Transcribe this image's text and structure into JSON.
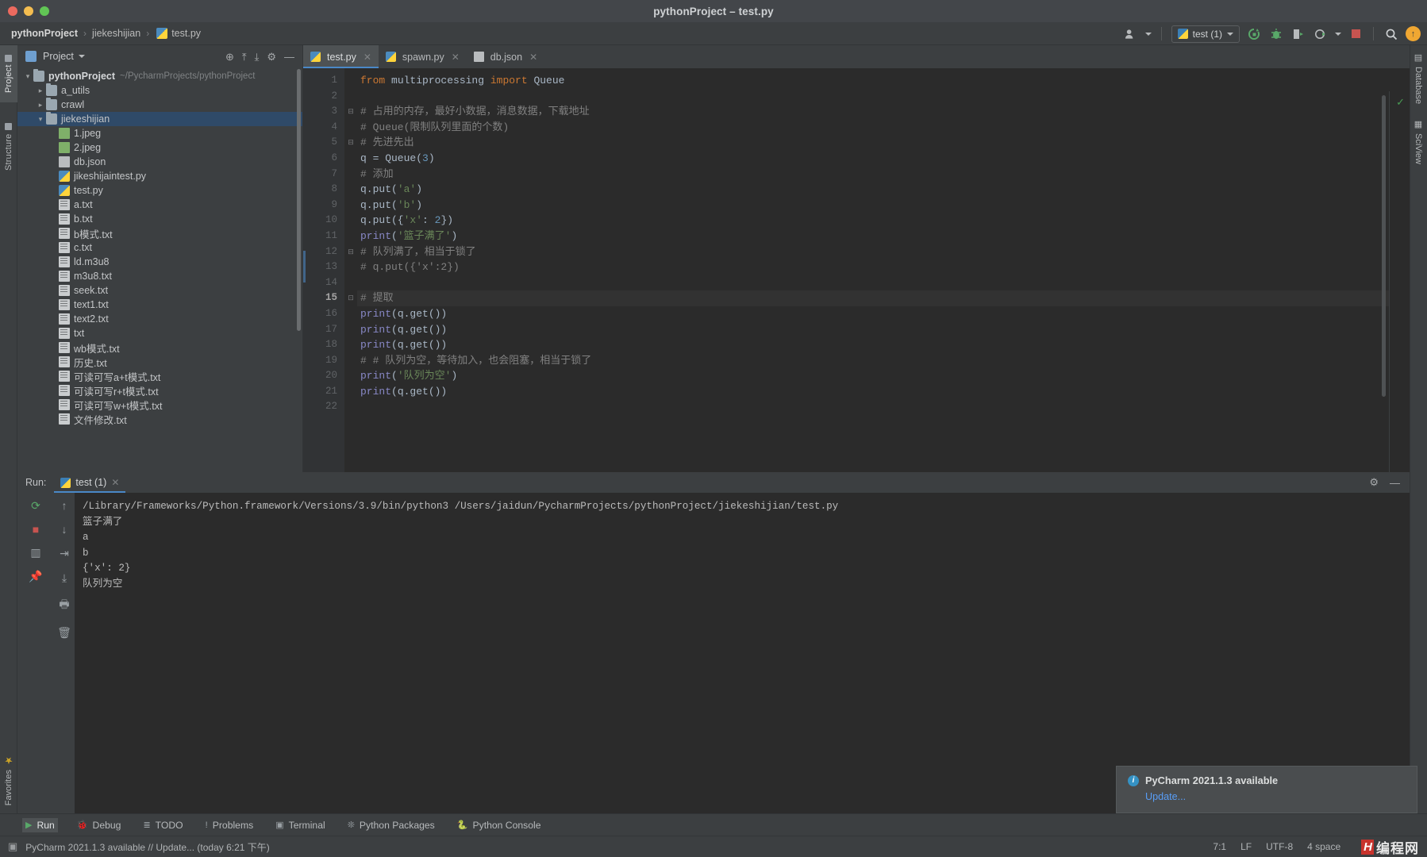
{
  "window": {
    "title": "pythonProject – test.py"
  },
  "breadcrumb": {
    "project": "pythonProject",
    "folder": "jiekeshijian",
    "file": "test.py",
    "separator": "›"
  },
  "toolbar": {
    "run_config": "test (1)",
    "icons": [
      "user-icon",
      "rerun-icon",
      "debug-icon",
      "coverage-icon",
      "profile-icon",
      "stop-icon",
      "search-icon",
      "update-icon"
    ]
  },
  "left_strip": {
    "tabs": [
      {
        "label": "Project",
        "icon": "folder-icon",
        "active": true
      },
      {
        "label": "Structure",
        "icon": "structure-icon",
        "active": false
      }
    ],
    "favorites": "Favorites"
  },
  "right_strip": {
    "tabs": [
      {
        "label": "Database",
        "icon": "database-icon"
      },
      {
        "label": "SciView",
        "icon": "grid-icon"
      }
    ]
  },
  "project_panel": {
    "title": "Project",
    "tools": [
      "target-icon",
      "collapse-icon",
      "expand-icon",
      "gear-icon",
      "minimize-icon"
    ],
    "tree": [
      {
        "indent": 0,
        "arrow": "v",
        "icon": "folder-icon",
        "name": "pythonProject",
        "bold": true,
        "path": "~/PycharmProjects/pythonProject",
        "selected": false
      },
      {
        "indent": 1,
        "arrow": ">",
        "icon": "folder-icon",
        "name": "a_utils",
        "bold": false,
        "path": "",
        "selected": false
      },
      {
        "indent": 1,
        "arrow": ">",
        "icon": "folder-icon",
        "name": "crawl",
        "bold": false,
        "path": "",
        "selected": false
      },
      {
        "indent": 1,
        "arrow": "v",
        "icon": "folder-icon",
        "name": "jiekeshijian",
        "bold": false,
        "path": "",
        "selected": true
      },
      {
        "indent": 2,
        "arrow": "",
        "icon": "image-icon",
        "name": "1.jpeg",
        "bold": false,
        "path": "",
        "selected": false
      },
      {
        "indent": 2,
        "arrow": "",
        "icon": "image-icon",
        "name": "2.jpeg",
        "bold": false,
        "path": "",
        "selected": false
      },
      {
        "indent": 2,
        "arrow": "",
        "icon": "json-icon",
        "name": "db.json",
        "bold": false,
        "path": "",
        "selected": false
      },
      {
        "indent": 2,
        "arrow": "",
        "icon": "python-icon",
        "name": "jikeshijaintest.py",
        "bold": false,
        "path": "",
        "selected": false
      },
      {
        "indent": 2,
        "arrow": "",
        "icon": "python-icon",
        "name": "test.py",
        "bold": false,
        "path": "",
        "selected": false
      },
      {
        "indent": 2,
        "arrow": "",
        "icon": "text-icon",
        "name": "a.txt",
        "bold": false,
        "path": "",
        "selected": false
      },
      {
        "indent": 2,
        "arrow": "",
        "icon": "text-icon",
        "name": "b.txt",
        "bold": false,
        "path": "",
        "selected": false
      },
      {
        "indent": 2,
        "arrow": "",
        "icon": "text-icon",
        "name": "b模式.txt",
        "bold": false,
        "path": "",
        "selected": false
      },
      {
        "indent": 2,
        "arrow": "",
        "icon": "text-icon",
        "name": "c.txt",
        "bold": false,
        "path": "",
        "selected": false
      },
      {
        "indent": 2,
        "arrow": "",
        "icon": "text-icon",
        "name": "ld.m3u8",
        "bold": false,
        "path": "",
        "selected": false
      },
      {
        "indent": 2,
        "arrow": "",
        "icon": "text-icon",
        "name": "m3u8.txt",
        "bold": false,
        "path": "",
        "selected": false
      },
      {
        "indent": 2,
        "arrow": "",
        "icon": "text-icon",
        "name": "seek.txt",
        "bold": false,
        "path": "",
        "selected": false
      },
      {
        "indent": 2,
        "arrow": "",
        "icon": "text-icon",
        "name": "text1.txt",
        "bold": false,
        "path": "",
        "selected": false
      },
      {
        "indent": 2,
        "arrow": "",
        "icon": "text-icon",
        "name": "text2.txt",
        "bold": false,
        "path": "",
        "selected": false
      },
      {
        "indent": 2,
        "arrow": "",
        "icon": "text-icon",
        "name": "txt",
        "bold": false,
        "path": "",
        "selected": false
      },
      {
        "indent": 2,
        "arrow": "",
        "icon": "text-icon",
        "name": "wb模式.txt",
        "bold": false,
        "path": "",
        "selected": false
      },
      {
        "indent": 2,
        "arrow": "",
        "icon": "text-icon",
        "name": "历史.txt",
        "bold": false,
        "path": "",
        "selected": false
      },
      {
        "indent": 2,
        "arrow": "",
        "icon": "text-icon",
        "name": "可读可写a+t模式.txt",
        "bold": false,
        "path": "",
        "selected": false
      },
      {
        "indent": 2,
        "arrow": "",
        "icon": "text-icon",
        "name": "可读可写r+t模式.txt",
        "bold": false,
        "path": "",
        "selected": false
      },
      {
        "indent": 2,
        "arrow": "",
        "icon": "text-icon",
        "name": "可读可写w+t模式.txt",
        "bold": false,
        "path": "",
        "selected": false
      },
      {
        "indent": 2,
        "arrow": "",
        "icon": "text-icon",
        "name": "文件修改.txt",
        "bold": false,
        "path": "",
        "selected": false
      }
    ]
  },
  "editor": {
    "tabs": [
      {
        "label": "test.py",
        "icon": "python-icon",
        "active": true
      },
      {
        "label": "spawn.py",
        "icon": "python-icon",
        "active": false
      },
      {
        "label": "db.json",
        "icon": "json-icon",
        "active": false
      }
    ],
    "current_line": 15,
    "lines": [
      {
        "n": 1,
        "fold": "",
        "html": "<span class=\"kw\">from</span> multiprocessing <span class=\"kw\">import</span> Queue"
      },
      {
        "n": 2,
        "fold": "",
        "html": ""
      },
      {
        "n": 3,
        "fold": "⊟",
        "html": "<span class=\"cmt\"># 占用的内存，最好小数据，消息数据，下载地址</span>"
      },
      {
        "n": 4,
        "fold": "",
        "html": "<span class=\"cmt\"># Queue(限制队列里面的个数)</span>"
      },
      {
        "n": 5,
        "fold": "⊟",
        "html": "<span class=\"cmt\"># 先进先出</span>"
      },
      {
        "n": 6,
        "fold": "",
        "html": "q = Queue(<span class=\"num\">3</span>)"
      },
      {
        "n": 7,
        "fold": "",
        "html": "<span class=\"cmt\"># 添加</span>"
      },
      {
        "n": 8,
        "fold": "",
        "html": "q.put(<span class=\"str\">'a'</span>)"
      },
      {
        "n": 9,
        "fold": "",
        "html": "q.put(<span class=\"str\">'b'</span>)"
      },
      {
        "n": 10,
        "fold": "",
        "html": "q.put({<span class=\"str\">'x'</span>: <span class=\"num\">2</span>})"
      },
      {
        "n": 11,
        "fold": "",
        "html": "<span class=\"fn\">print</span>(<span class=\"str\">'篮子满了'</span>)"
      },
      {
        "n": 12,
        "fold": "⊟",
        "html": "<span class=\"cmt\"># 队列满了，相当于锁了</span>"
      },
      {
        "n": 13,
        "fold": "",
        "html": "<span class=\"cmt\"># q.put({'x':2})</span>"
      },
      {
        "n": 14,
        "fold": "",
        "html": ""
      },
      {
        "n": 15,
        "fold": "⊡",
        "html": "<span class=\"cmt\"># 提取</span>"
      },
      {
        "n": 16,
        "fold": "",
        "html": "<span class=\"fn\">print</span>(q.get())"
      },
      {
        "n": 17,
        "fold": "",
        "html": "<span class=\"fn\">print</span>(q.get())"
      },
      {
        "n": 18,
        "fold": "",
        "html": "<span class=\"fn\">print</span>(q.get())"
      },
      {
        "n": 19,
        "fold": "",
        "html": "<span class=\"cmt\"># # 队列为空，等待加入，也会阻塞，相当于锁了</span>"
      },
      {
        "n": 20,
        "fold": "",
        "html": "<span class=\"fn\">print</span>(<span class=\"str\">'队列为空'</span>)"
      },
      {
        "n": 21,
        "fold": "",
        "html": "<span class=\"fn\">print</span>(q.get())"
      },
      {
        "n": 22,
        "fold": "",
        "html": ""
      }
    ],
    "plain_lines": [
      "from multiprocessing import Queue",
      "",
      "# 占用的内存，最好小数据，消息数据，下载地址",
      "# Queue(限制队列里面的个数)",
      "# 先进先出",
      "q = Queue(3)",
      "# 添加",
      "q.put('a')",
      "q.put('b')",
      "q.put({'x': 2})",
      "print('篮子满了')",
      "# 队列满了，相当于锁了",
      "# q.put({'x':2})",
      "",
      "# 提取",
      "print(q.get())",
      "print(q.get())",
      "print(q.get())",
      "# # 队列为空，等待加入，也会阻塞，相当于锁了",
      "print('队列为空')",
      "print(q.get())",
      ""
    ]
  },
  "run_panel": {
    "label": "Run:",
    "tab": "test (1)",
    "sidebar_icons": [
      "rerun-icon",
      "stop-icon",
      "layout-icon",
      "pin-icon",
      "scroll-up-icon",
      "scroll-down-icon",
      "soft-wrap-icon",
      "scroll-to-end-icon",
      "print-icon",
      "trash-icon"
    ],
    "header_icons": [
      "settings-icon",
      "minimize-icon"
    ],
    "console": [
      "/Library/Frameworks/Python.framework/Versions/3.9/bin/python3 /Users/jaidun/PycharmProjects/pythonProject/jiekeshijian/test.py",
      "篮子满了",
      "a",
      "b",
      "{'x': 2}",
      "队列为空"
    ]
  },
  "notification": {
    "title": "PyCharm 2021.1.3 available",
    "link": "Update..."
  },
  "bottom_bar": {
    "items": [
      {
        "label": "Run",
        "icon": "run-icon",
        "active": true
      },
      {
        "label": "Debug",
        "icon": "debug-icon",
        "active": false
      },
      {
        "label": "TODO",
        "icon": "todo-icon",
        "active": false
      },
      {
        "label": "Problems",
        "icon": "problems-icon",
        "active": false
      },
      {
        "label": "Terminal",
        "icon": "terminal-icon",
        "active": false
      },
      {
        "label": "Python Packages",
        "icon": "packages-icon",
        "active": false
      },
      {
        "label": "Python Console",
        "icon": "python-console-icon",
        "active": false
      }
    ]
  },
  "status_bar": {
    "message": "PyCharm 2021.1.3 available // Update... (today 6:21 下午)",
    "caret": "7:1",
    "line_separator": "LF",
    "encoding": "UTF-8",
    "indent": "4 space",
    "watermark_mark": "H",
    "watermark_text": "编程网"
  },
  "colors": {
    "accent": "#4a88c7",
    "selection": "#2f4a68",
    "editor_bg": "#2b2b2b",
    "panel_bg": "#3c3f41",
    "green": "#59a869",
    "red": "#c75450",
    "link": "#589df6"
  }
}
